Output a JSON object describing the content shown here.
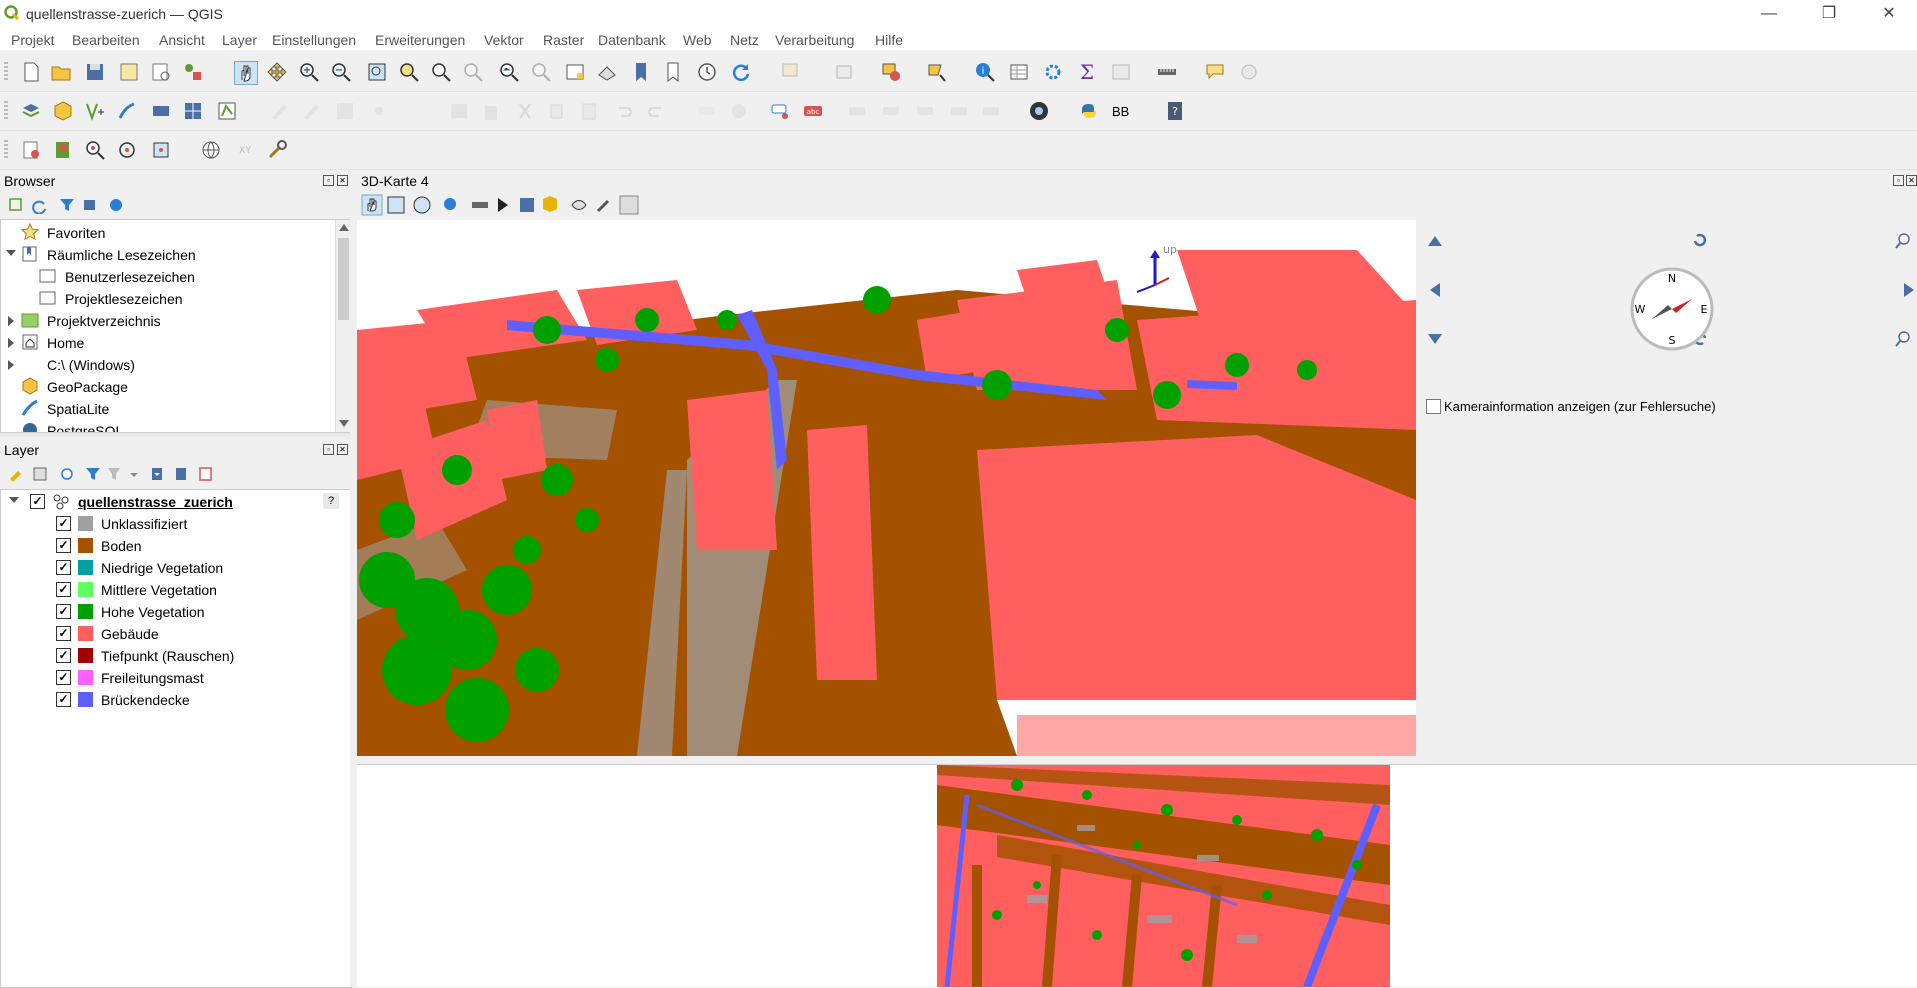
{
  "window": {
    "title": "quellenstrasse-zuerich — QGIS",
    "controls": [
      "—",
      "❐",
      "✕"
    ]
  },
  "menu": [
    "Projekt",
    "Bearbeiten",
    "Ansicht",
    "Layer",
    "Einstellungen",
    "Erweiterungen",
    "Vektor",
    "Raster",
    "Datenbank",
    "Web",
    "Netz",
    "Verarbeitung",
    "Hilfe"
  ],
  "toolbar_text": {
    "bb": "BB"
  },
  "browser": {
    "title": "Browser",
    "items": [
      {
        "label": "Favoriten",
        "icon": "star-icon"
      },
      {
        "label": "Räumliche Lesezeichen",
        "icon": "bookmark-icon"
      },
      {
        "label": "Benutzerlesezeichen",
        "icon": "folder-icon"
      },
      {
        "label": "Projektlesezeichen",
        "icon": "folder-icon"
      },
      {
        "label": "Projektverzeichnis",
        "icon": "project-folder-icon"
      },
      {
        "label": "Home",
        "icon": "home-icon"
      },
      {
        "label": "C:\\ (Windows)",
        "icon": "drive-icon"
      },
      {
        "label": "GeoPackage",
        "icon": "geopackage-icon"
      },
      {
        "label": "SpatiaLite",
        "icon": "spatialite-icon"
      },
      {
        "label": "PostgreSQL",
        "icon": "postgresql-icon"
      }
    ]
  },
  "layers": {
    "title": "Layer",
    "root": "quellenstrasse_zuerich",
    "help": "?",
    "classes": [
      {
        "label": "Unklassifiziert",
        "color": "#a0a0a0"
      },
      {
        "label": "Boden",
        "color": "#a45200"
      },
      {
        "label": "Niedrige Vegetation",
        "color": "#00a0a0"
      },
      {
        "label": "Mittlere Vegetation",
        "color": "#5fff5f"
      },
      {
        "label": "Hohe Vegetation",
        "color": "#00a000"
      },
      {
        "label": "Gebäude",
        "color": "#ff5f5f"
      },
      {
        "label": "Tiefpunkt (Rauschen)",
        "color": "#a00000"
      },
      {
        "label": "Freileitungsmast",
        "color": "#ff5fff"
      },
      {
        "label": "Brückendecke",
        "color": "#5f5fff"
      }
    ]
  },
  "view3d": {
    "title": "3D-Karte 4",
    "axis_up": "up",
    "camera_info_label": "Kamerainformation anzeigen (zur Fehlersuche)",
    "compass": {
      "n": "N",
      "e": "E",
      "s": "S",
      "w": "W"
    }
  }
}
